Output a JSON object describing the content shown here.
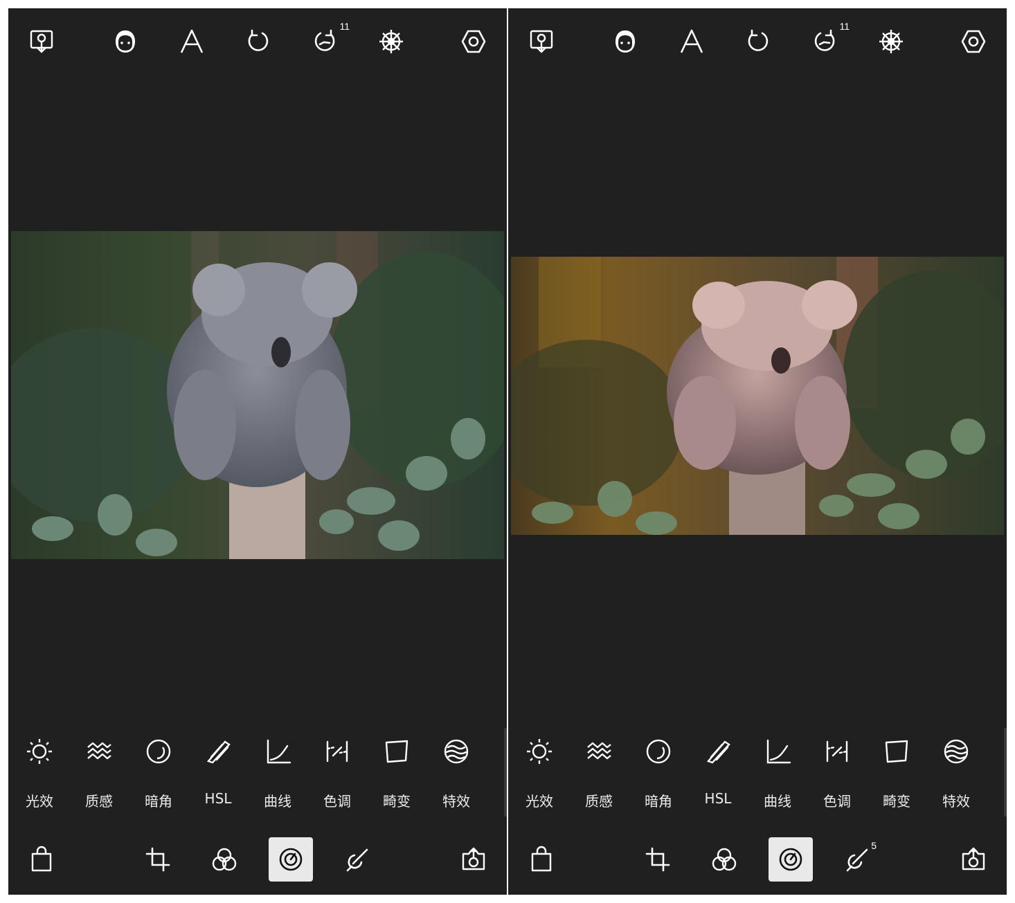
{
  "colors": {
    "background": "#202020",
    "icon": "#ffffff",
    "label": "#ececec",
    "active_tab": "#e9e9e9"
  },
  "panels": [
    {
      "id": "before",
      "top_bar": {
        "icons": [
          "import-icon",
          "face-icon",
          "text-icon",
          "undo-icon",
          "redo-icon",
          "wheel-icon",
          "settings-icon"
        ],
        "redo_count": "11"
      },
      "photo": {
        "subject": "koala",
        "tint": "cool-green"
      },
      "tools": [
        {
          "label": "光效",
          "icon": "sun-icon"
        },
        {
          "label": "质感",
          "icon": "texture-icon"
        },
        {
          "label": "暗角",
          "icon": "vignette-icon"
        },
        {
          "label": "HSL",
          "icon": "hsl-icon"
        },
        {
          "label": "曲线",
          "icon": "curve-icon"
        },
        {
          "label": "色调",
          "icon": "split-tone-icon"
        },
        {
          "label": "畸变",
          "icon": "distortion-icon"
        },
        {
          "label": "特效",
          "icon": "effects-icon"
        }
      ],
      "bottom_bar": {
        "icons": [
          "shop-icon",
          "crop-icon",
          "filter-icon",
          "adjust-icon",
          "brush-icon",
          "export-icon"
        ],
        "active": "adjust-icon",
        "brush_count": ""
      }
    },
    {
      "id": "after",
      "top_bar": {
        "icons": [
          "import-icon",
          "face-icon",
          "text-icon",
          "undo-icon",
          "redo-icon",
          "wheel-icon",
          "settings-icon"
        ],
        "redo_count": "11"
      },
      "photo": {
        "subject": "koala",
        "tint": "warm-pink"
      },
      "tools": [
        {
          "label": "光效",
          "icon": "sun-icon"
        },
        {
          "label": "质感",
          "icon": "texture-icon"
        },
        {
          "label": "暗角",
          "icon": "vignette-icon"
        },
        {
          "label": "HSL",
          "icon": "hsl-icon"
        },
        {
          "label": "曲线",
          "icon": "curve-icon"
        },
        {
          "label": "色调",
          "icon": "split-tone-icon"
        },
        {
          "label": "畸变",
          "icon": "distortion-icon"
        },
        {
          "label": "特效",
          "icon": "effects-icon"
        }
      ],
      "bottom_bar": {
        "icons": [
          "shop-icon",
          "crop-icon",
          "filter-icon",
          "adjust-icon",
          "brush-icon",
          "export-icon"
        ],
        "active": "adjust-icon",
        "brush_count": "5"
      }
    }
  ]
}
